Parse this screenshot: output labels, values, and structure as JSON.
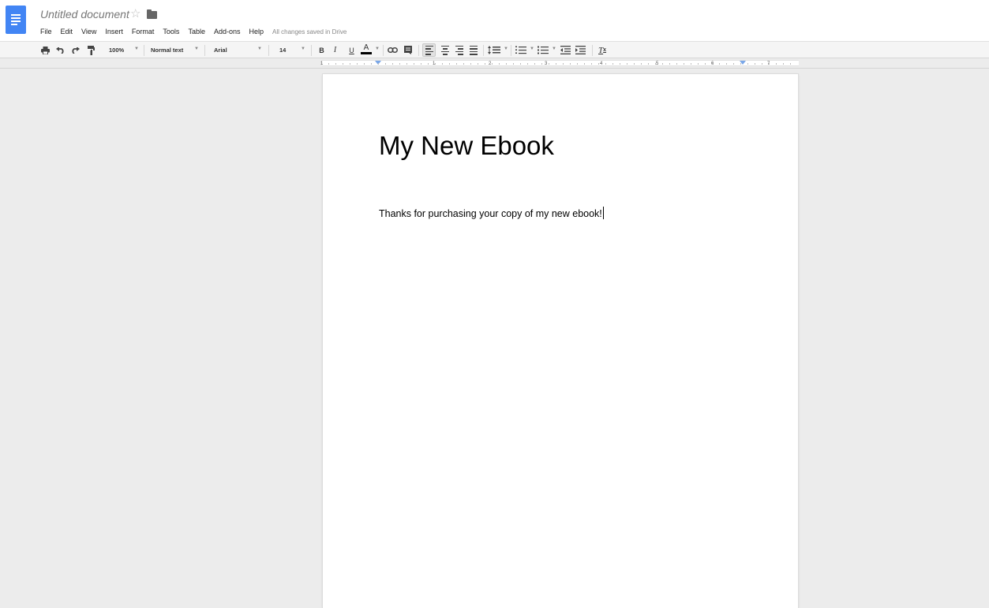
{
  "header": {
    "doc_title": "Untitled document",
    "save_status": "All changes saved in Drive"
  },
  "menu": [
    "File",
    "Edit",
    "View",
    "Insert",
    "Format",
    "Tools",
    "Table",
    "Add-ons",
    "Help"
  ],
  "toolbar": {
    "zoom": "100%",
    "style": "Normal text",
    "font": "Arial",
    "font_size": "14",
    "bold": "B",
    "italic": "I",
    "underline": "U",
    "text_color": "A",
    "clear_formatting": "T"
  },
  "ruler": {
    "numbers": [
      "1",
      "1",
      "2",
      "3",
      "4",
      "5",
      "6",
      "7"
    ]
  },
  "document": {
    "heading": "My New Ebook",
    "body": "Thanks for purchasing your copy of my new ebook!"
  },
  "colors": {
    "brand": "#4285f4",
    "indent_marker": "#7aa7e8"
  },
  "icons": [
    "docs-app-icon",
    "star-icon",
    "folder-icon",
    "print-icon",
    "undo-icon",
    "redo-icon",
    "paint-format-icon",
    "link-icon",
    "comment-icon",
    "align-left-icon",
    "align-center-icon",
    "align-right-icon",
    "justify-icon",
    "line-spacing-icon",
    "numbered-list-icon",
    "bulleted-list-icon",
    "decrease-indent-icon",
    "increase-indent-icon",
    "clear-formatting-icon"
  ]
}
